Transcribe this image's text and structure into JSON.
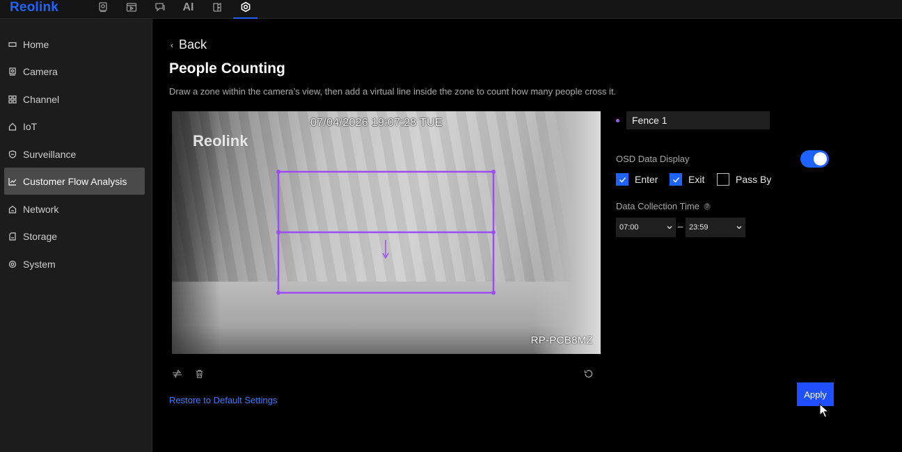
{
  "app": {
    "logo": "Reolink",
    "accent_color": "#1f63ff"
  },
  "topnav": [
    {
      "icon": "live-view-icon",
      "active": false
    },
    {
      "icon": "playback-icon",
      "active": false
    },
    {
      "icon": "messages-icon",
      "active": false
    },
    {
      "icon": "ai-label",
      "label": "AI",
      "active": false
    },
    {
      "icon": "door-icon",
      "active": false
    },
    {
      "icon": "settings-icon",
      "active": true
    }
  ],
  "sidebar": {
    "items": [
      {
        "label": "Home",
        "icon": "home-icon",
        "active": false
      },
      {
        "label": "Camera",
        "icon": "camera-icon",
        "active": false
      },
      {
        "label": "Channel",
        "icon": "channel-icon",
        "active": false
      },
      {
        "label": "IoT",
        "icon": "iot-icon",
        "active": false
      },
      {
        "label": "Surveillance",
        "icon": "shield-icon",
        "active": false
      },
      {
        "label": "Customer Flow Analysis",
        "icon": "chart-icon",
        "active": true
      },
      {
        "label": "Network",
        "icon": "network-icon",
        "active": false
      },
      {
        "label": "Storage",
        "icon": "storage-icon",
        "active": false
      },
      {
        "label": "System",
        "icon": "system-icon",
        "active": false
      }
    ]
  },
  "main": {
    "back_label": "Back",
    "title": "People Counting",
    "description": "Draw a zone within the camera’s view, then add a virtual line inside the zone to count how many people cross it.",
    "video": {
      "timestamp": "07/04/2026 19:07:28 TUE",
      "watermark": "Reolink",
      "camera_name": "RP-PCB8MZ",
      "zone_color": "#9c4df5"
    },
    "restore_label": "Restore to Default Settings"
  },
  "panel": {
    "fence_name": "Fence 1",
    "osd_label": "OSD Data Display",
    "osd_enabled": true,
    "checkboxes": [
      {
        "label": "Enter",
        "checked": true
      },
      {
        "label": "Exit",
        "checked": true
      },
      {
        "label": "Pass By",
        "checked": false
      }
    ],
    "collection_label": "Data Collection Time",
    "help_glyph": "?",
    "start_time": "07:00",
    "end_time": "23:59",
    "range_separator": "–",
    "apply_label": "Apply"
  }
}
